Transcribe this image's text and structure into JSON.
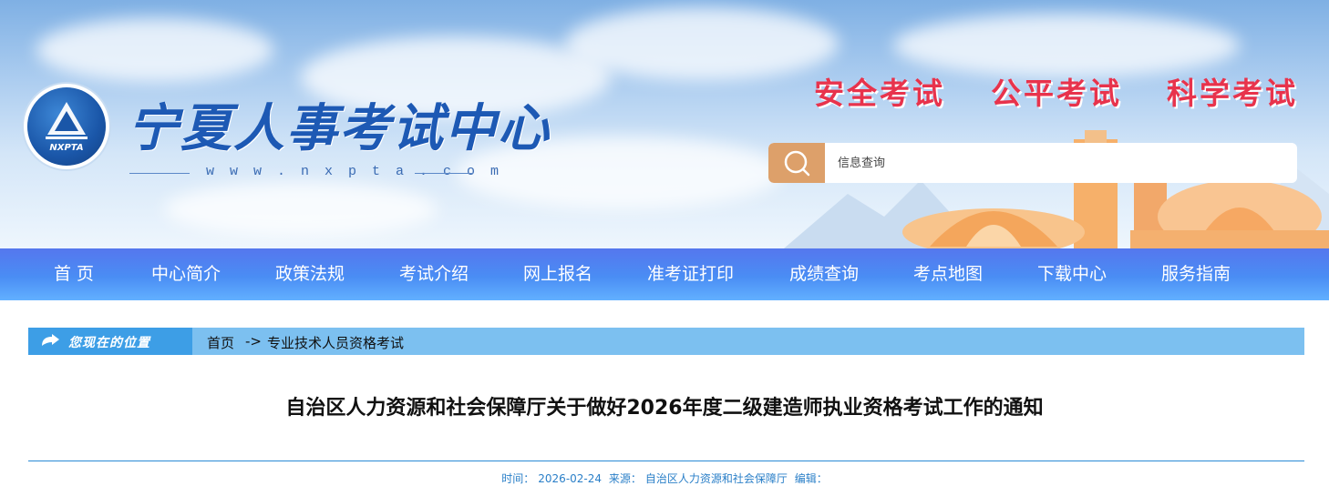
{
  "header": {
    "site_name": "宁夏人事考试中心",
    "site_url": "w w w . n x p t a . c o m",
    "logo_abbr": "NXPTA",
    "slogans": [
      "安全考试",
      "公平考试",
      "科学考试"
    ],
    "search": {
      "placeholder": "信息查询"
    }
  },
  "nav": {
    "items": [
      {
        "label": "首  页"
      },
      {
        "label": "中心简介"
      },
      {
        "label": "政策法规"
      },
      {
        "label": "考试介绍"
      },
      {
        "label": "网上报名"
      },
      {
        "label": "准考证打印"
      },
      {
        "label": "成绩查询"
      },
      {
        "label": "考点地图"
      },
      {
        "label": "下载中心"
      },
      {
        "label": "服务指南"
      }
    ]
  },
  "breadcrumb": {
    "label": "您现在的位置",
    "home": "首页",
    "separator": "->",
    "current": "专业技术人员资格考试"
  },
  "article": {
    "title": "自治区人力资源和社会保障厅关于做好2026年度二级建造师执业资格考试工作的通知",
    "meta": {
      "time_label": "时间：",
      "time_value": "2026-02-24",
      "source_label": "来源：",
      "source_value": "自治区人力资源和社会保障厅",
      "editor_label": "编辑："
    }
  },
  "colors": {
    "nav_top": "#5577ee",
    "nav_bottom": "#62b0ff",
    "slogan": "#e8334c",
    "search_button": "#dda06a",
    "breadcrumb_bg": "#7cc0f0",
    "meta_text": "#2a7fc8"
  },
  "icons": [
    "logo-emblem-icon",
    "search-icon",
    "location-arrow-icon"
  ]
}
